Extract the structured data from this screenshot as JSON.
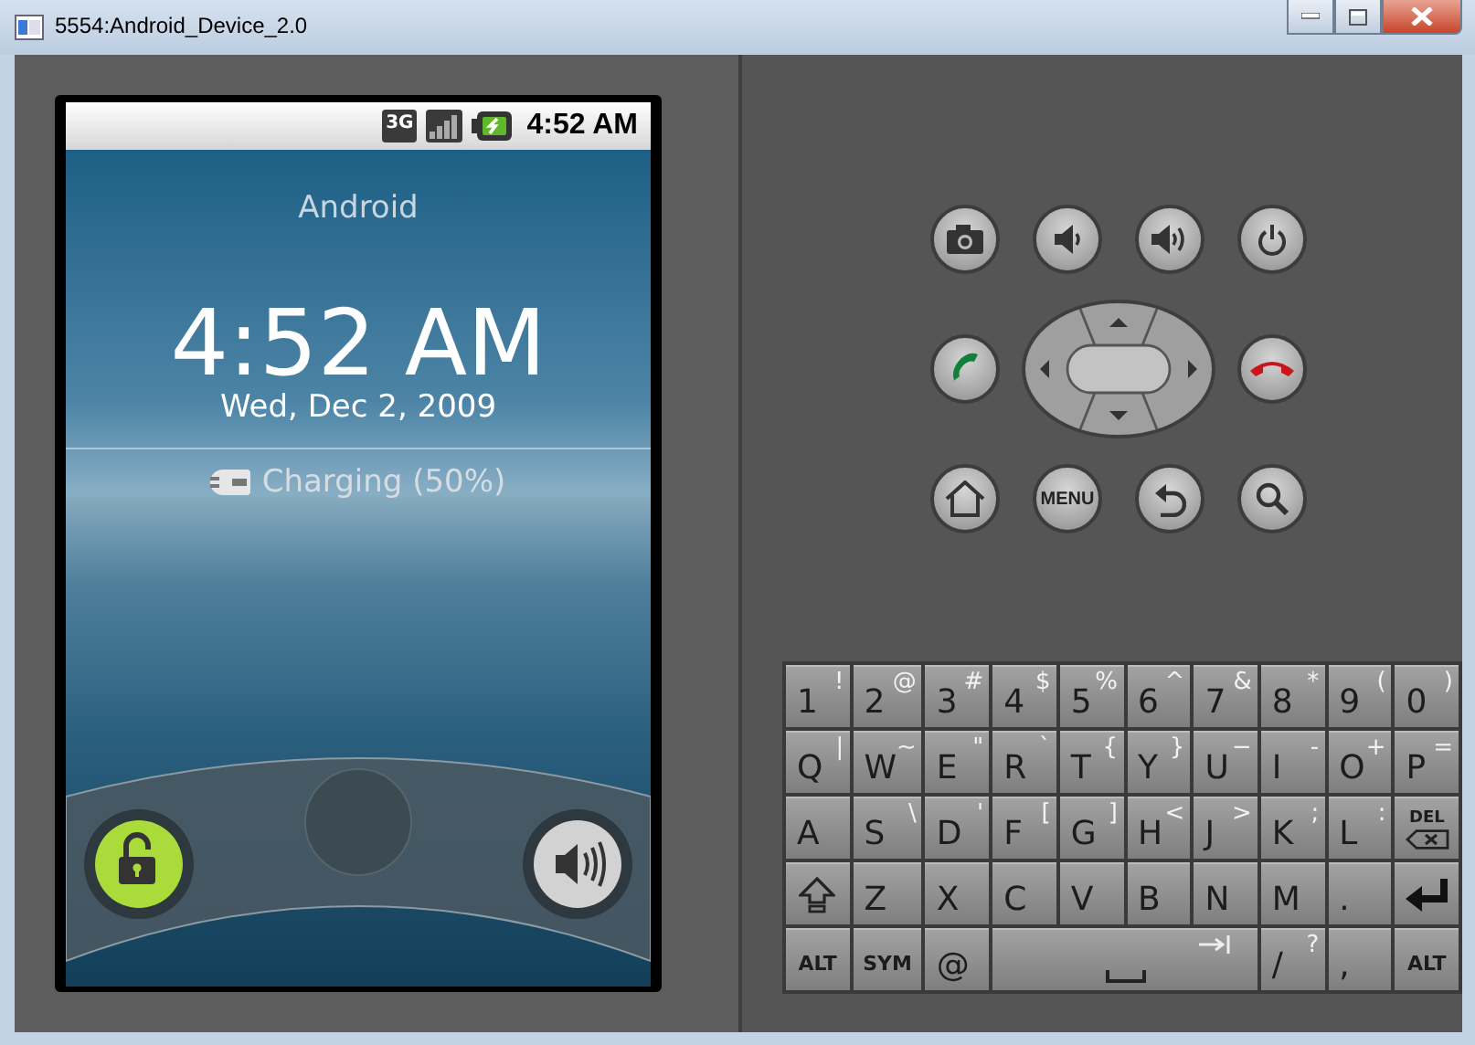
{
  "window": {
    "title": "5554:Android_Device_2.0"
  },
  "status_bar": {
    "network": "3G",
    "time": "4:52 AM"
  },
  "lock_screen": {
    "carrier": "Android",
    "time": "4:52 AM",
    "date": "Wed, Dec 2, 2009",
    "charging": "Charging (50%)"
  },
  "hardware_buttons": [
    [
      {
        "kind": "camera"
      },
      {
        "kind": "volume-down"
      },
      {
        "kind": "volume-up"
      },
      {
        "kind": "power"
      }
    ],
    [
      {
        "kind": "call"
      },
      {
        "kind": "dpad"
      },
      {
        "kind": "end-call"
      }
    ],
    [
      {
        "kind": "home"
      },
      {
        "kind": "menu",
        "label": "MENU"
      },
      {
        "kind": "back"
      },
      {
        "kind": "search"
      }
    ]
  ],
  "keyboard": [
    [
      {
        "kind": "char",
        "label": "1",
        "alt": "!"
      },
      {
        "kind": "char",
        "label": "2",
        "alt": "@"
      },
      {
        "kind": "char",
        "label": "3",
        "alt": "#"
      },
      {
        "kind": "char",
        "label": "4",
        "alt": "$"
      },
      {
        "kind": "char",
        "label": "5",
        "alt": "%"
      },
      {
        "kind": "char",
        "label": "6",
        "alt": "^"
      },
      {
        "kind": "char",
        "label": "7",
        "alt": "&"
      },
      {
        "kind": "char",
        "label": "8",
        "alt": "*"
      },
      {
        "kind": "char",
        "label": "9",
        "alt": "("
      },
      {
        "kind": "char",
        "label": "0",
        "alt": ")"
      }
    ],
    [
      {
        "kind": "char",
        "label": "Q",
        "alt": "|"
      },
      {
        "kind": "char",
        "label": "W",
        "alt": "~"
      },
      {
        "kind": "char",
        "label": "E",
        "alt": "\""
      },
      {
        "kind": "char",
        "label": "R",
        "alt": "`"
      },
      {
        "kind": "char",
        "label": "T",
        "alt": "{"
      },
      {
        "kind": "char",
        "label": "Y",
        "alt": "}"
      },
      {
        "kind": "char",
        "label": "U",
        "alt": "−"
      },
      {
        "kind": "char",
        "label": "I",
        "alt": "-"
      },
      {
        "kind": "char",
        "label": "O",
        "alt": "+"
      },
      {
        "kind": "char",
        "label": "P",
        "alt": "="
      }
    ],
    [
      {
        "kind": "char",
        "label": "A"
      },
      {
        "kind": "char",
        "label": "S",
        "alt": "\\"
      },
      {
        "kind": "char",
        "label": "D",
        "alt": "'"
      },
      {
        "kind": "char",
        "label": "F",
        "alt": "["
      },
      {
        "kind": "char",
        "label": "G",
        "alt": "]"
      },
      {
        "kind": "char",
        "label": "H",
        "alt": "<"
      },
      {
        "kind": "char",
        "label": "J",
        "alt": ">"
      },
      {
        "kind": "char",
        "label": "K",
        "alt": ";"
      },
      {
        "kind": "char",
        "label": "L",
        "alt": ":"
      },
      {
        "kind": "delete",
        "label": "DEL"
      }
    ],
    [
      {
        "kind": "shift"
      },
      {
        "kind": "char",
        "label": "Z"
      },
      {
        "kind": "char",
        "label": "X"
      },
      {
        "kind": "char",
        "label": "C"
      },
      {
        "kind": "char",
        "label": "V"
      },
      {
        "kind": "char",
        "label": "B"
      },
      {
        "kind": "char",
        "label": "N"
      },
      {
        "kind": "char",
        "label": "M"
      },
      {
        "kind": "char",
        "label": "."
      },
      {
        "kind": "enter"
      }
    ],
    [
      {
        "kind": "mod",
        "label": "ALT"
      },
      {
        "kind": "mod",
        "label": "SYM"
      },
      {
        "kind": "char",
        "label": "@"
      },
      {
        "kind": "space"
      },
      {
        "kind": "char",
        "label": "/",
        "alt": "?"
      },
      {
        "kind": "char",
        "label": ","
      },
      {
        "kind": "mod",
        "label": "ALT"
      }
    ]
  ]
}
